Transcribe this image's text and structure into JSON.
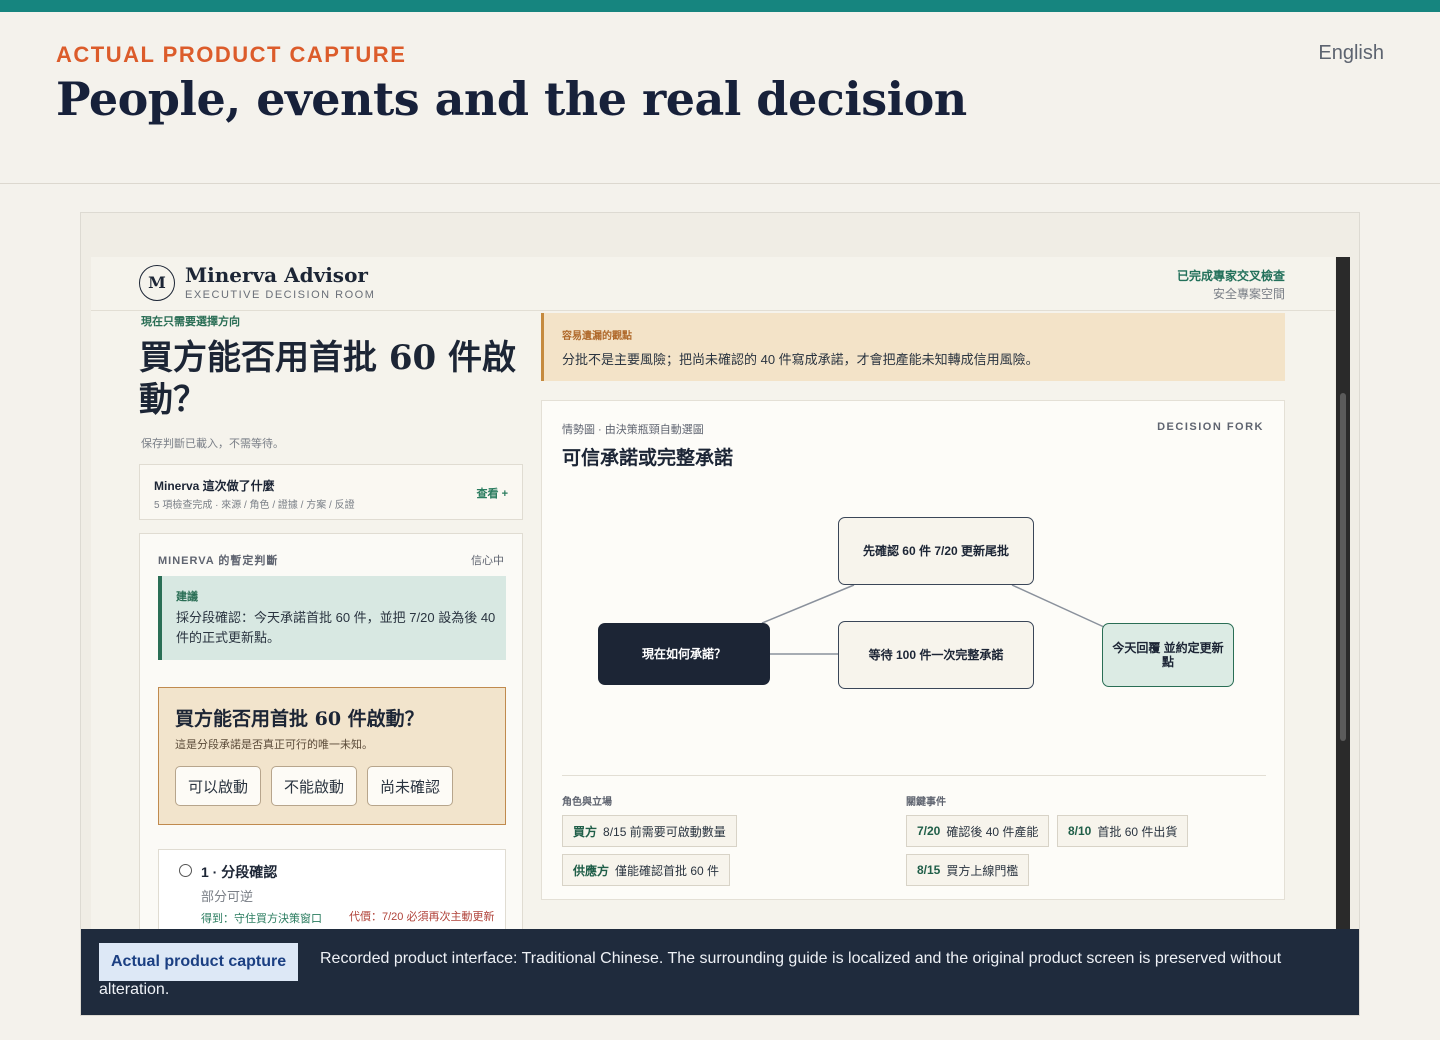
{
  "guide": {
    "eyebrow": "ACTUAL PRODUCT CAPTURE",
    "title": "People, events and the real decision",
    "language": "English",
    "colors": {
      "accent_bar": "#16857f",
      "eyebrow": "#dc5c2b"
    }
  },
  "app": {
    "logo_letter": "M",
    "brand": "Minerva Advisor",
    "brand_sub": "EXECUTIVE DECISION ROOM",
    "status": "已完成專家交叉檢查",
    "status_sub": "安全專案空間",
    "left": {
      "kicker": "現在只需要選擇方向",
      "question": "買方能否用首批 60 件啟動？",
      "saved_note": "保存判斷已載入，不需等待。",
      "did": {
        "title": "Minerva 這次做了什麼",
        "sub": "5 項檢查完成 · 來源 / 角色 / 證據 / 方案 / 反證",
        "link": "查看 +"
      },
      "judgement": {
        "label": "MINERVA 的暫定判斷",
        "confidence": "信心中",
        "rec_label": "建議",
        "rec_text": "採分段確認：今天承諾首批 60 件，並把 7/20 設為後 40 件的正式更新點。",
        "unknown": {
          "title": "買方能否用首批 60 件啟動？",
          "sub": "這是分段承諾是否真正可行的唯一未知。",
          "options": [
            "可以啟動",
            "不能啟動",
            "尚未確認"
          ]
        },
        "path": {
          "title": "1 · 分段確認",
          "sub": "部分可逆",
          "gain": "得到：守住買方決策窗口",
          "cost": "代價：7/20 必須再次主動更新"
        }
      }
    },
    "blind_spot": {
      "label": "容易遺漏的觀點",
      "text": "分批不是主要風險；把尚未確認的 40 件寫成承諾，才會把產能未知轉成信用風險。"
    },
    "situation": {
      "label": "情勢圖 · 由決策瓶頸自動選圖",
      "fork": "DECISION FORK",
      "title": "可信承諾或完整承諾",
      "nodes": {
        "root": "現在如何承諾？",
        "a": "先確認 60 件 7/20 更新尾批",
        "b": "等待 100 件一次完整承諾",
        "c": "今天回覆 並約定更新點"
      },
      "roles_label": "角色與立場",
      "events_label": "關鍵事件",
      "roles": [
        {
          "who": "買方",
          "what": "8/15 前需要可啟動數量"
        },
        {
          "who": "供應方",
          "what": "僅能確認首批 60 件"
        }
      ],
      "events": [
        {
          "when": "7/20",
          "what": "確認後 40 件產能"
        },
        {
          "when": "8/10",
          "what": "首批 60 件出貨"
        },
        {
          "when": "8/15",
          "what": "買方上線門檻"
        }
      ]
    }
  },
  "caption": {
    "badge": "Actual product capture",
    "text": "Recorded product interface: Traditional Chinese. The surrounding guide is localized and the original product screen is preserved without alteration."
  }
}
